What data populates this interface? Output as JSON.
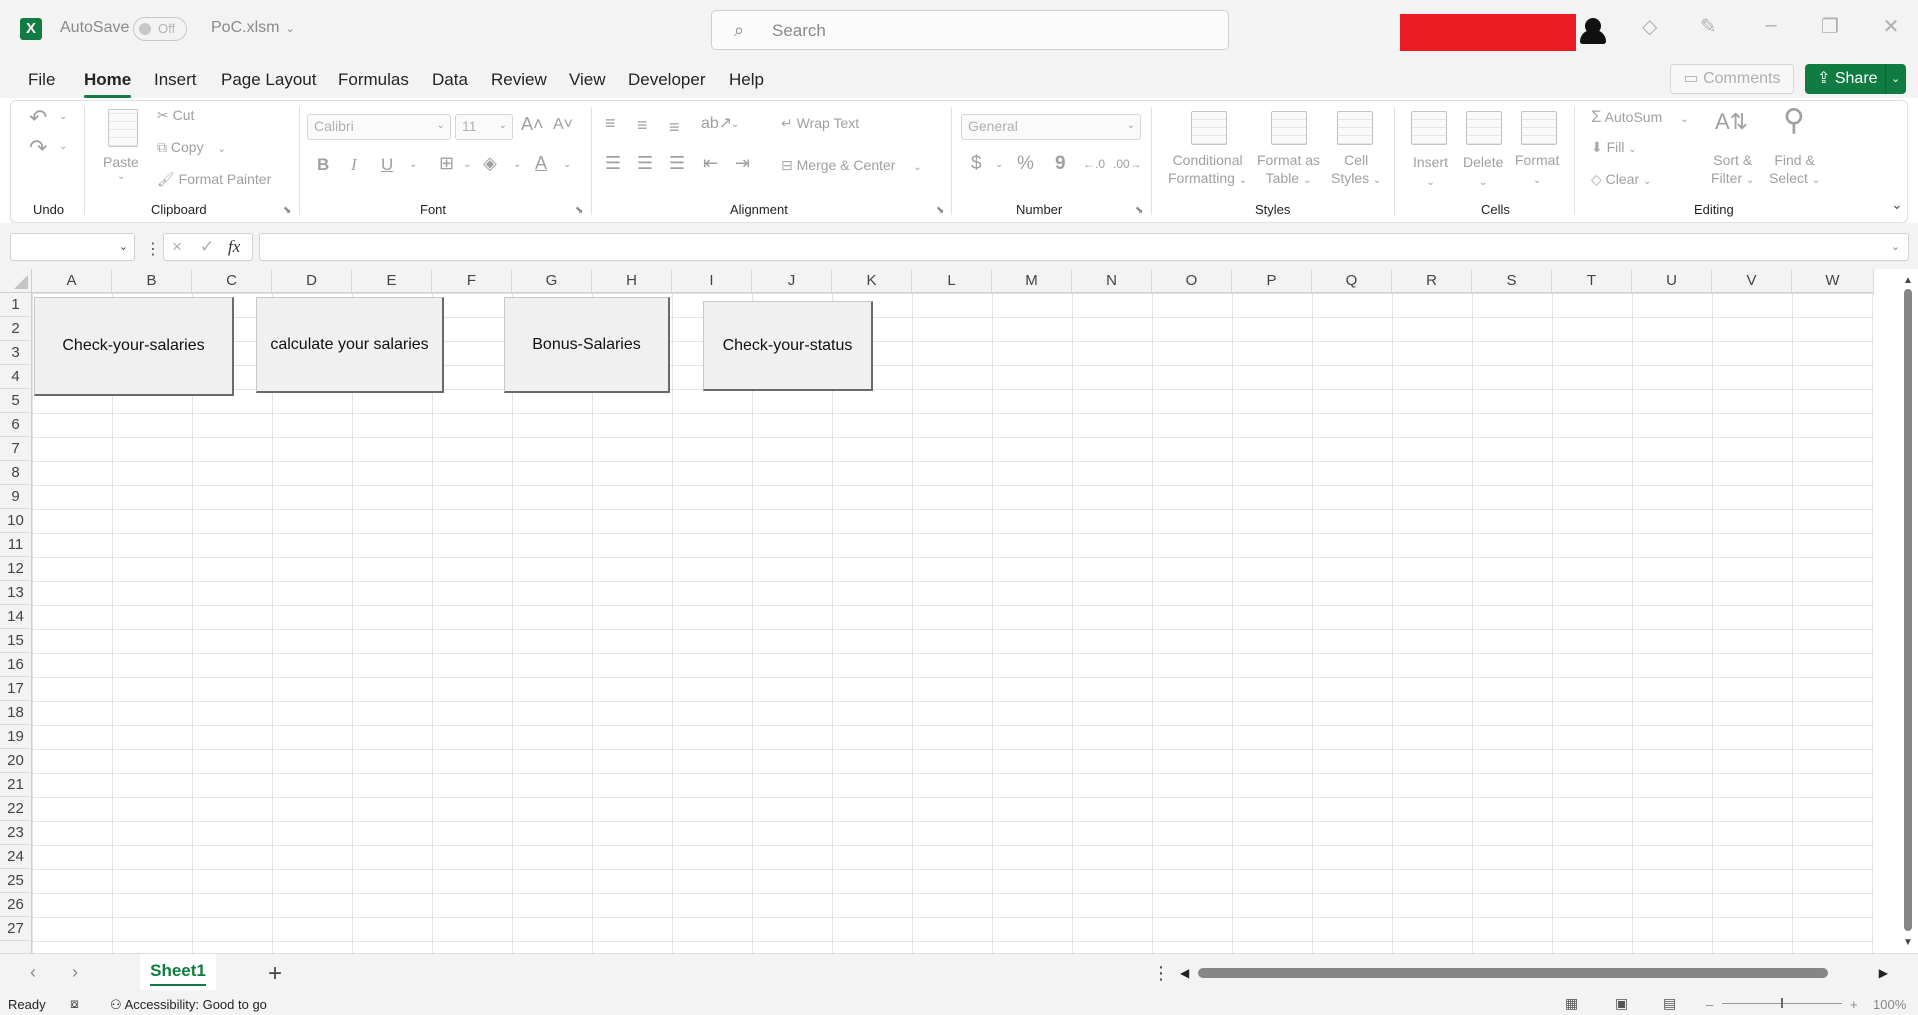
{
  "title_bar": {
    "app_logo": "X",
    "autosave_label": "AutoSave",
    "autosave_state": "Off",
    "file_name": "PoC.xlsm",
    "search_placeholder": "Search",
    "icons": [
      "excel-logo-icon",
      "search-icon",
      "diamond-icon",
      "pen-icon",
      "minimize-icon",
      "restore-icon",
      "close-icon"
    ],
    "redaction_color": "#ec1c24"
  },
  "menu": {
    "tabs": [
      "File",
      "Home",
      "Insert",
      "Page Layout",
      "Formulas",
      "Data",
      "Review",
      "View",
      "Developer",
      "Help"
    ],
    "active_tab": "Home",
    "comments_label": "Comments",
    "share_label": "Share"
  },
  "ribbon": {
    "groups": {
      "undo": "Undo",
      "clipboard": "Clipboard",
      "font": "Font",
      "alignment": "Alignment",
      "number": "Number",
      "styles": "Styles",
      "cells": "Cells",
      "editing": "Editing"
    },
    "clipboard": {
      "paste": "Paste",
      "cut": "Cut",
      "copy": "Copy",
      "format_painter": "Format Painter"
    },
    "font": {
      "name": "Calibri",
      "size": "11",
      "bold": "B",
      "italic": "I",
      "underline": "U"
    },
    "alignment": {
      "wrap_text": "Wrap Text",
      "merge_center": "Merge & Center"
    },
    "number": {
      "format": "General",
      "currency": "$",
      "percent": "%",
      "comma": "9"
    },
    "styles": {
      "conditional_1": "Conditional",
      "conditional_2": "Formatting",
      "format_table_1": "Format as",
      "format_table_2": "Table",
      "cell_styles_1": "Cell",
      "cell_styles_2": "Styles"
    },
    "cells": {
      "insert": "Insert",
      "delete": "Delete",
      "format": "Format"
    },
    "editing": {
      "autosum": "AutoSum",
      "fill": "Fill",
      "clear": "Clear",
      "sort_1": "Sort &",
      "sort_2": "Filter",
      "find_1": "Find &",
      "find_2": "Select"
    }
  },
  "formula_bar": {
    "fx_label": "fx",
    "cancel": "×",
    "enter": "✓"
  },
  "grid": {
    "columns": [
      "A",
      "B",
      "C",
      "D",
      "E",
      "F",
      "G",
      "H",
      "I",
      "J",
      "K",
      "L",
      "M",
      "N",
      "O",
      "P",
      "Q",
      "R",
      "S",
      "T",
      "U",
      "V",
      "W"
    ],
    "rows": [
      "1",
      "2",
      "3",
      "4",
      "5",
      "6",
      "7",
      "8",
      "9",
      "10",
      "11",
      "12",
      "13",
      "14",
      "15",
      "16",
      "17",
      "18",
      "19",
      "20",
      "21",
      "22",
      "23",
      "24",
      "25",
      "26",
      "27"
    ],
    "buttons": [
      {
        "label": "Check-your-salaries"
      },
      {
        "label": "calculate your salaries"
      },
      {
        "label": "Bonus-Salaries"
      },
      {
        "label": "Check-your-status"
      }
    ]
  },
  "sheet_tabs": {
    "active": "Sheet1",
    "add": "+"
  },
  "status_bar": {
    "ready": "Ready",
    "accessibility": "Accessibility: Good to go",
    "zoom": "100%"
  }
}
